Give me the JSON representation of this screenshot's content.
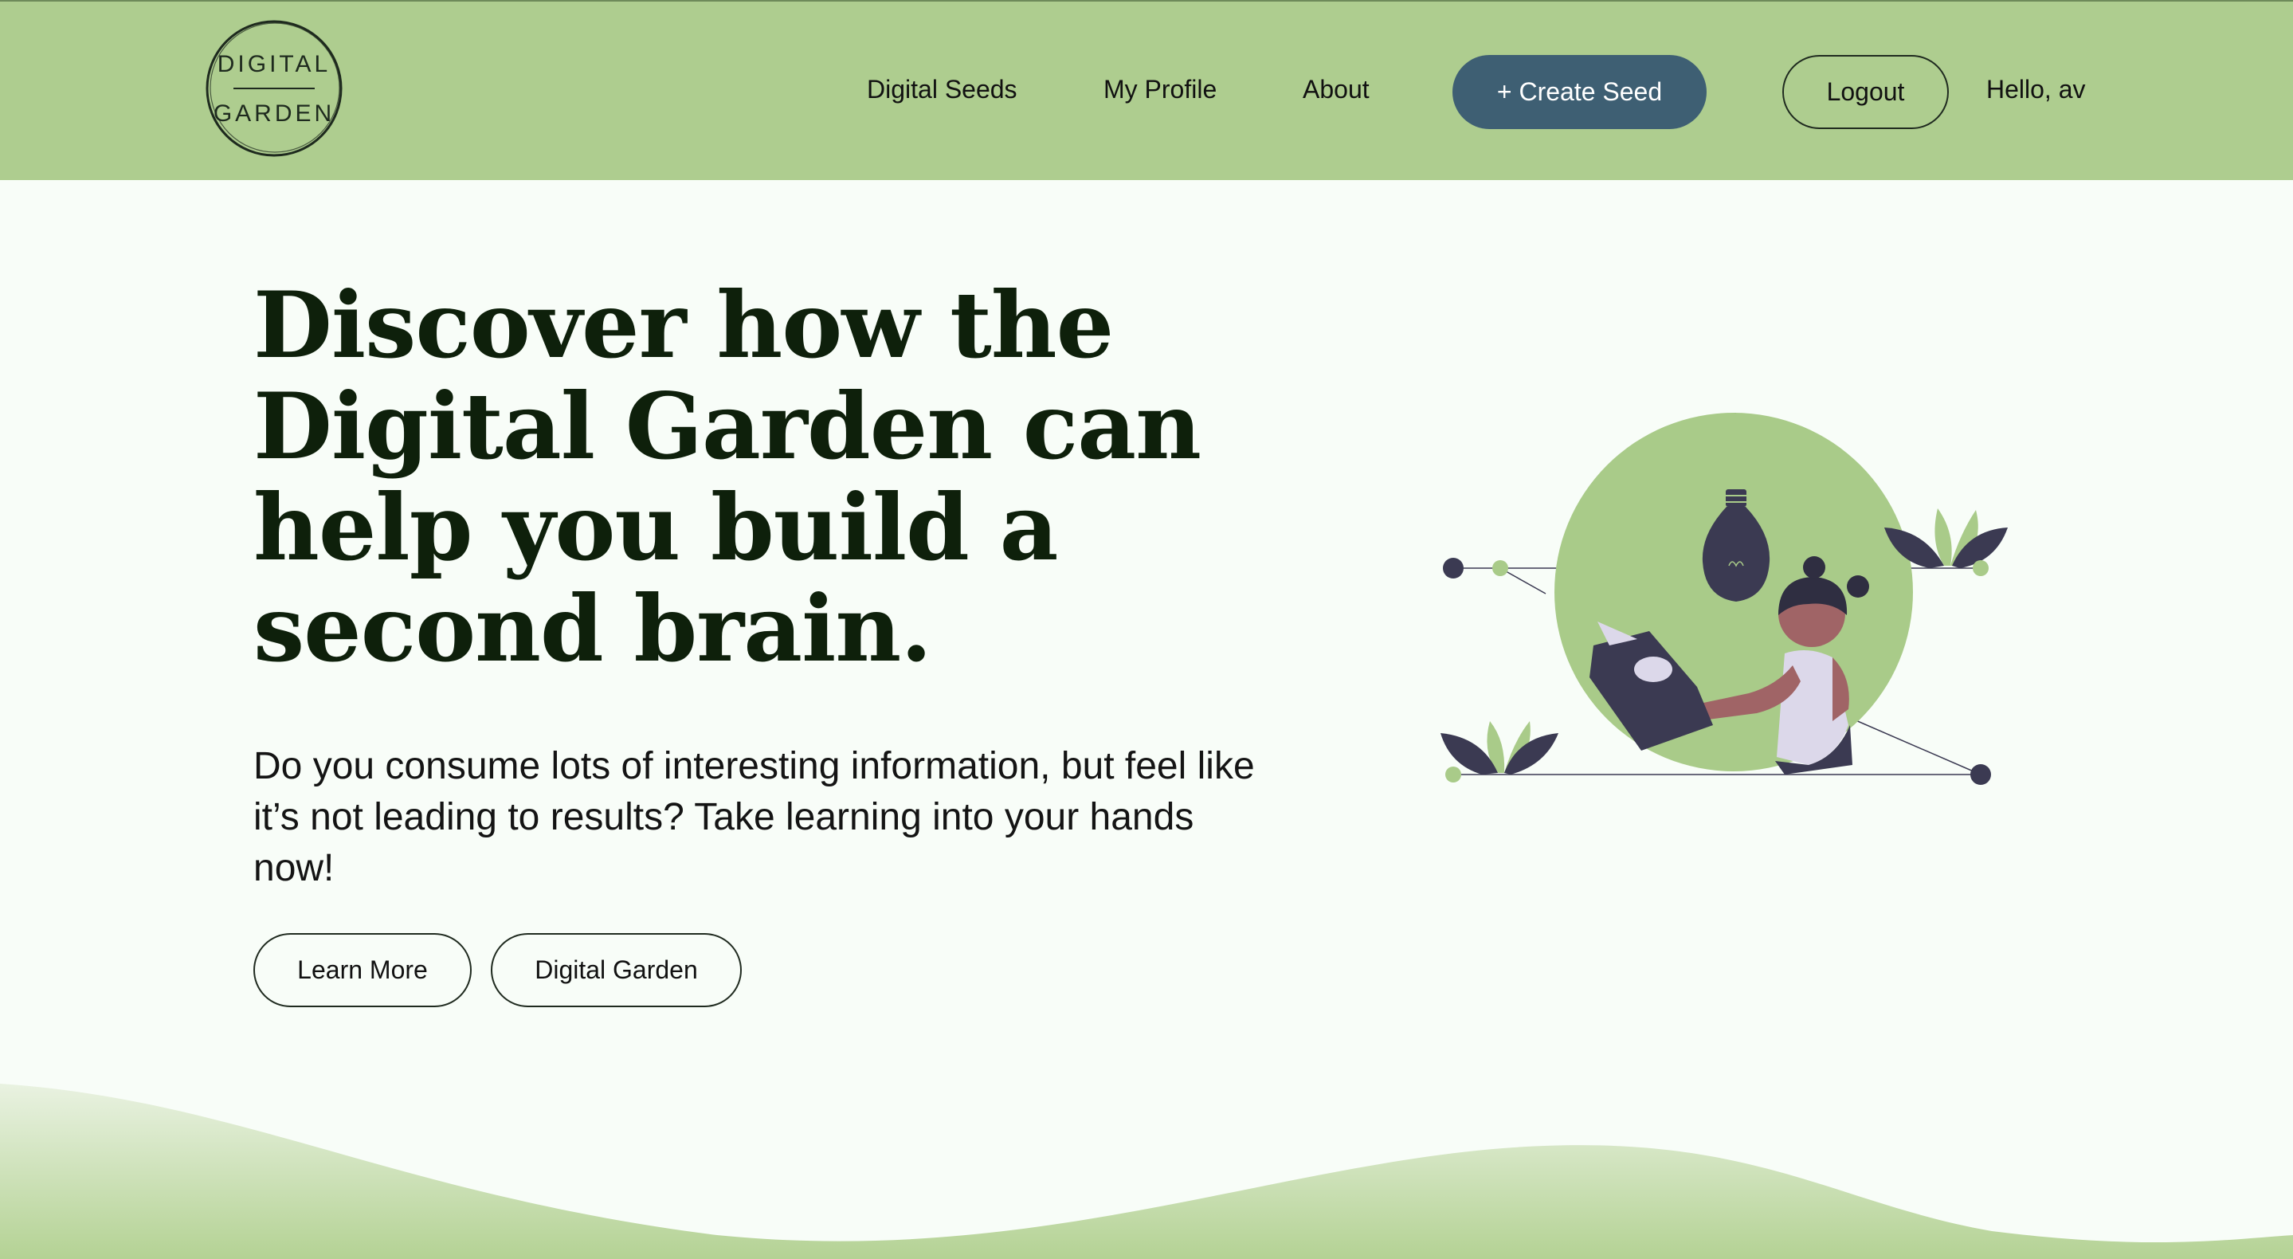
{
  "header": {
    "logo": {
      "line1": "DIGITAL",
      "line2": "GARDEN"
    },
    "nav": [
      {
        "label": "Digital Seeds"
      },
      {
        "label": "My Profile"
      },
      {
        "label": "About"
      }
    ],
    "create_label": "+ Create Seed",
    "logout_label": "Logout",
    "greeting": "Hello, av"
  },
  "hero": {
    "title": "Discover how the Digital Garden can help you build a second brain.",
    "subtitle": "Do you consume lots of interesting information, but feel like it’s not leading to results? Take learning into your hands now!",
    "buttons": [
      {
        "label": "Learn More"
      },
      {
        "label": "Digital Garden"
      }
    ]
  },
  "colors": {
    "header_bg": "#aecd8f",
    "page_bg": "#f8fdf8",
    "accent_button": "#3e5f73",
    "title_text": "#0e200b",
    "illustration_green": "#a9cb89",
    "illustration_dark": "#3b3a52"
  }
}
